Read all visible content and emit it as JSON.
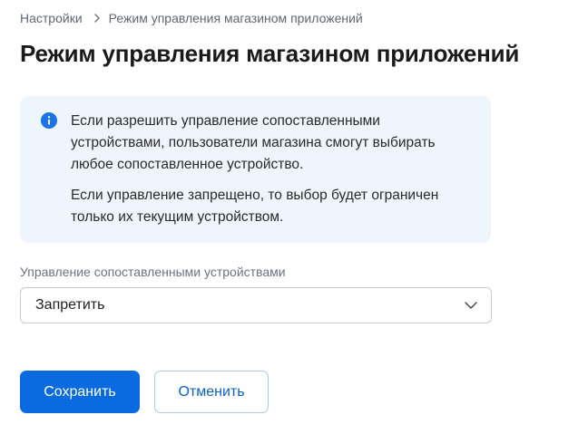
{
  "breadcrumb": {
    "parent": "Настройки",
    "current": "Режим управления магазином приложений"
  },
  "page": {
    "title": "Режим управления магазином приложений"
  },
  "info": {
    "icon": "info-icon",
    "accent_color": "#1a73e8",
    "paragraph_1": "Если разрешить управление сопоставленными устройствами, пользователи магазина смогут выбирать любое сопоставленное устройство.",
    "paragraph_2": "Если управление запрещено, то выбор будет ограничен только их текущим устройством."
  },
  "field": {
    "label": "Управление сопоставленными устройствами",
    "selected_value": "Запретить",
    "icon": "chevron-down-icon"
  },
  "actions": {
    "save_label": "Сохранить",
    "cancel_label": "Отменить",
    "primary_color": "#0a6be0"
  }
}
